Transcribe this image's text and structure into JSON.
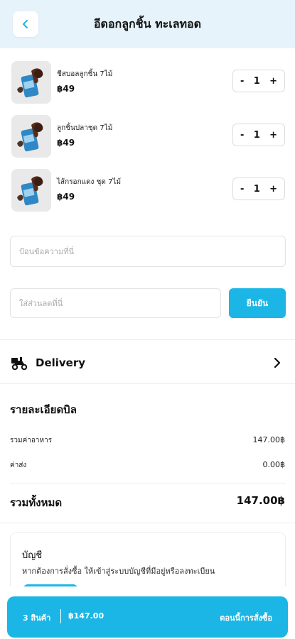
{
  "header": {
    "title": "อีดอกลูกชิ้น ทะเลทอด",
    "back_icon": "chevron-left-icon"
  },
  "cart_items": [
    {
      "name": "ชีสบอลลูกชิ้น 7ไม้",
      "price": "฿49",
      "quantity": "1"
    },
    {
      "name": "ลูกชิ้นปลาชุด 7ไม้",
      "price": "฿49",
      "quantity": "1"
    },
    {
      "name": "ไส้กรอกแดง ชุด 7ไม้",
      "price": "฿49",
      "quantity": "1"
    }
  ],
  "stepper": {
    "minus": "-",
    "plus": "+"
  },
  "note": {
    "placeholder": "ป้อนข้อความที่นี่"
  },
  "coupon": {
    "placeholder": "ใส่ส่วนลดที่นี่",
    "confirm_label": "ยืนยัน"
  },
  "delivery": {
    "label": "Delivery",
    "icon": "delivery-bike-icon"
  },
  "bill": {
    "title": "รายละเอียดบิล",
    "food_total_label": "รวมค่าอาหาร",
    "food_total_value": "147.00฿",
    "delivery_fee_label": "ค่าส่ง",
    "delivery_fee_value": "0.00฿",
    "grand_total_label": "รวมทั้งหมด",
    "grand_total_value": "147.00฿"
  },
  "account": {
    "title": "บัญชี",
    "description": "หากต้องการสั่งซื้อ ให้เข้าสู่ระบบบัญชีที่มีอยู่หรือลงทะเบียน"
  },
  "checkout": {
    "count": "3 สินค้า",
    "total": "฿147.00",
    "action": "ตอนนี้การสั่งซื้อ"
  },
  "colors": {
    "accent": "#1bb6e6",
    "header_bg": "#e6f3fb"
  }
}
